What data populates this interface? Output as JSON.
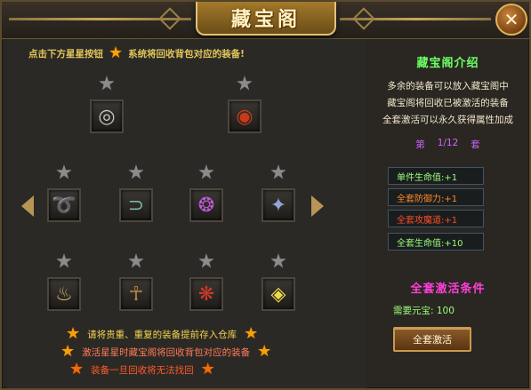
{
  "window": {
    "title": "藏宝阁",
    "close_icon": "close-x-icon"
  },
  "hint_top": {
    "text_before": "点击下方星星按钮",
    "text_after": "系统将回收背包对应的装备!"
  },
  "slots": {
    "row1": [
      {
        "id": "ring-silver",
        "icon": "silver-ring-icon",
        "glyph": "◎"
      },
      {
        "id": "ring-red",
        "icon": "red-gem-ring-icon",
        "glyph": "◉"
      }
    ],
    "row2": [
      {
        "id": "dragon-bracelet",
        "icon": "gold-dragon-bracelet-icon",
        "glyph": "➰"
      },
      {
        "id": "bracer",
        "icon": "bracer-icon",
        "glyph": "⊃"
      },
      {
        "id": "amulet",
        "icon": "purple-gem-amulet-icon",
        "glyph": "❂"
      },
      {
        "id": "gauntlet",
        "icon": "spiked-gauntlet-icon",
        "glyph": "✦"
      }
    ],
    "row3": [
      {
        "id": "tooth",
        "icon": "tooth-pendant-icon",
        "glyph": "♨"
      },
      {
        "id": "claw",
        "icon": "claw-glove-icon",
        "glyph": "☥"
      },
      {
        "id": "red-necklace",
        "icon": "red-orb-necklace-icon",
        "glyph": "❋"
      },
      {
        "id": "gold-gem",
        "icon": "gold-gem-icon",
        "glyph": "◈"
      }
    ]
  },
  "notes": {
    "line1": "请将贵重、重复的装备提前存入仓库",
    "line2": "激活星星时藏宝阁将回收背包对应的装备",
    "line3": "装备一旦回收将无法找回"
  },
  "right": {
    "title": "藏宝阁介绍",
    "desc": [
      "多余的装备可以放入藏宝阁中",
      "藏宝阁将回收已被激活的装备",
      "全套激活可以永久获得属性加成"
    ],
    "set_prefix": "第",
    "set_value": "1/12",
    "set_suffix": "套",
    "stats": [
      {
        "label": "单件生命值:+1",
        "color": "green"
      },
      {
        "label": "全套防御力:+1",
        "color": "orange"
      },
      {
        "label": "全套攻魔道:+1",
        "color": "red"
      },
      {
        "label": "全套生命值:+10",
        "color": "green"
      }
    ],
    "condition_title": "全套激活条件",
    "need": "需要元宝: 100",
    "activate_button": "全套激活"
  },
  "colors": {
    "star_active": "#f5a20a",
    "star_inactive": "#8c8c8c",
    "accent_gold": "#c9a65a"
  }
}
